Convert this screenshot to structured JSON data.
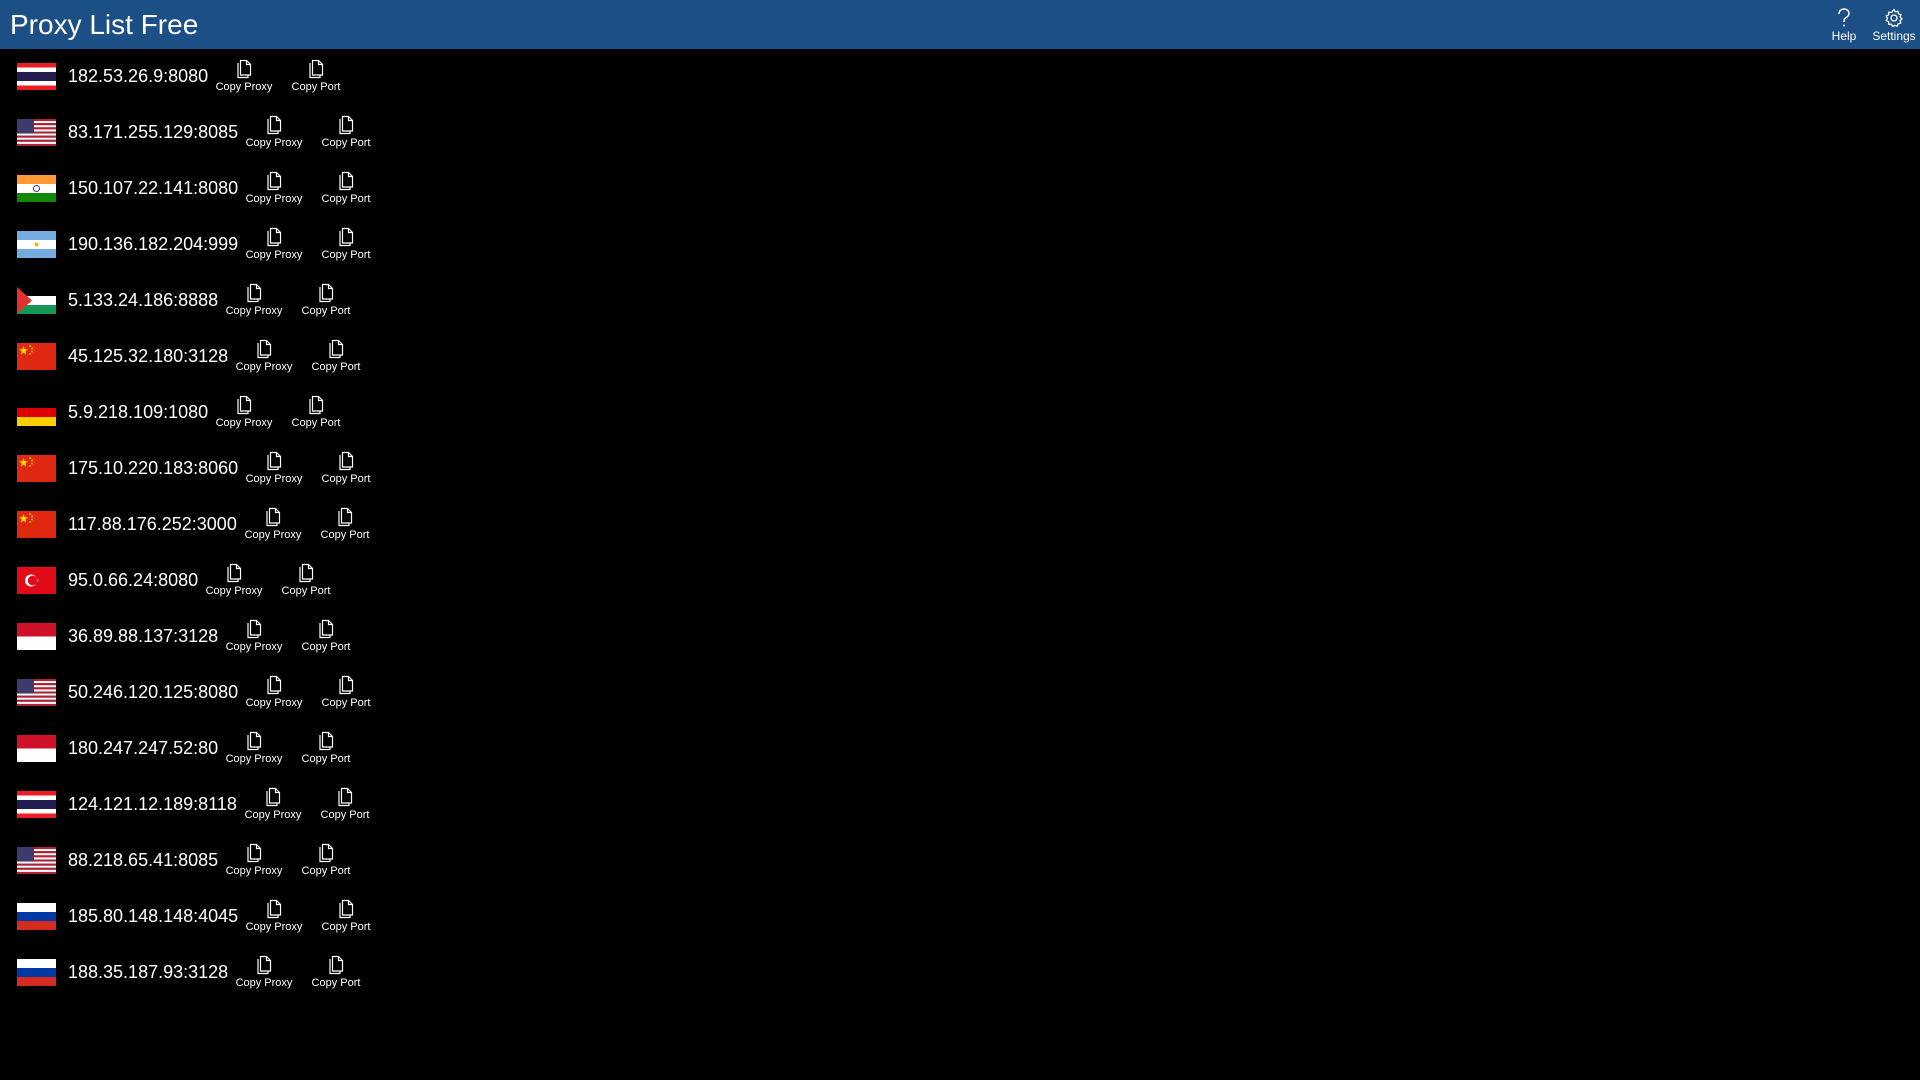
{
  "app": {
    "title": "Proxy List Free"
  },
  "commands": {
    "help_label": "Help",
    "settings_label": "Settings"
  },
  "labels": {
    "copy_proxy": "Copy Proxy",
    "copy_port": "Copy Port"
  },
  "icons": {
    "help": "question-mark-icon",
    "settings": "gear-icon",
    "copy": "copy-icon"
  },
  "colors": {
    "titlebar": "#1b4f86",
    "background": "#000000",
    "text": "#ffffff"
  },
  "proxies": [
    {
      "address": "182.53.26.9:8080",
      "flag": "thailand"
    },
    {
      "address": "83.171.255.129:8085",
      "flag": "usa"
    },
    {
      "address": "150.107.22.141:8080",
      "flag": "india"
    },
    {
      "address": "190.136.182.204:999",
      "flag": "argentina"
    },
    {
      "address": "5.133.24.186:8888",
      "flag": "palestine"
    },
    {
      "address": "45.125.32.180:3128",
      "flag": "china"
    },
    {
      "address": "5.9.218.109:1080",
      "flag": "germany"
    },
    {
      "address": "175.10.220.183:8060",
      "flag": "china"
    },
    {
      "address": "117.88.176.252:3000",
      "flag": "china"
    },
    {
      "address": "95.0.66.24:8080",
      "flag": "turkey"
    },
    {
      "address": "36.89.88.137:3128",
      "flag": "indonesia"
    },
    {
      "address": "50.246.120.125:8080",
      "flag": "usa"
    },
    {
      "address": "180.247.247.52:80",
      "flag": "indonesia"
    },
    {
      "address": "124.121.12.189:8118",
      "flag": "thailand"
    },
    {
      "address": "88.218.65.41:8085",
      "flag": "usa"
    },
    {
      "address": "185.80.148.148:4045",
      "flag": "russia"
    },
    {
      "address": "188.35.187.93:3128",
      "flag": "russia"
    }
  ]
}
